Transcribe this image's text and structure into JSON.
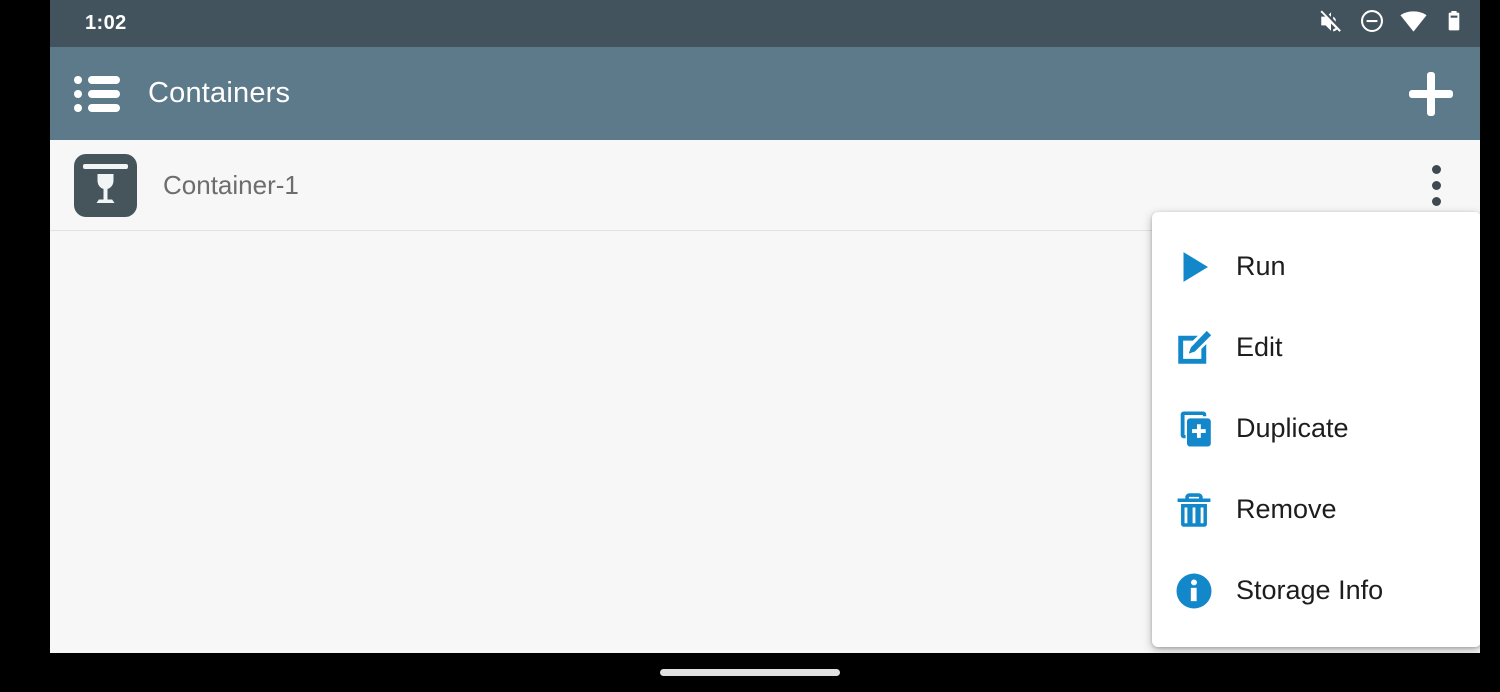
{
  "status_bar": {
    "time": "1:02",
    "icons": [
      {
        "name": "volume-off-icon"
      },
      {
        "name": "do-not-disturb-icon"
      },
      {
        "name": "wifi-icon"
      },
      {
        "name": "battery-icon"
      }
    ],
    "background_color": "#42535d"
  },
  "toolbar": {
    "title": "Containers",
    "menu_icon": "list-menu-icon",
    "add_icon": "plus-icon",
    "background_color": "#5d7a8a"
  },
  "list": {
    "rows": [
      {
        "label": "Container-1",
        "icon": "wine-container-icon",
        "overflow_icon": "more-vertical-icon"
      }
    ]
  },
  "popup_menu": {
    "visible": true,
    "accent_color": "#1288ca",
    "items": [
      {
        "label": "Run",
        "icon": "play-icon"
      },
      {
        "label": "Edit",
        "icon": "edit-pencil-icon"
      },
      {
        "label": "Duplicate",
        "icon": "copy-plus-icon"
      },
      {
        "label": "Remove",
        "icon": "trash-icon"
      },
      {
        "label": "Storage Info",
        "icon": "info-circle-icon"
      }
    ]
  },
  "navigation": {
    "gesture_pill": "home-gesture-pill"
  }
}
